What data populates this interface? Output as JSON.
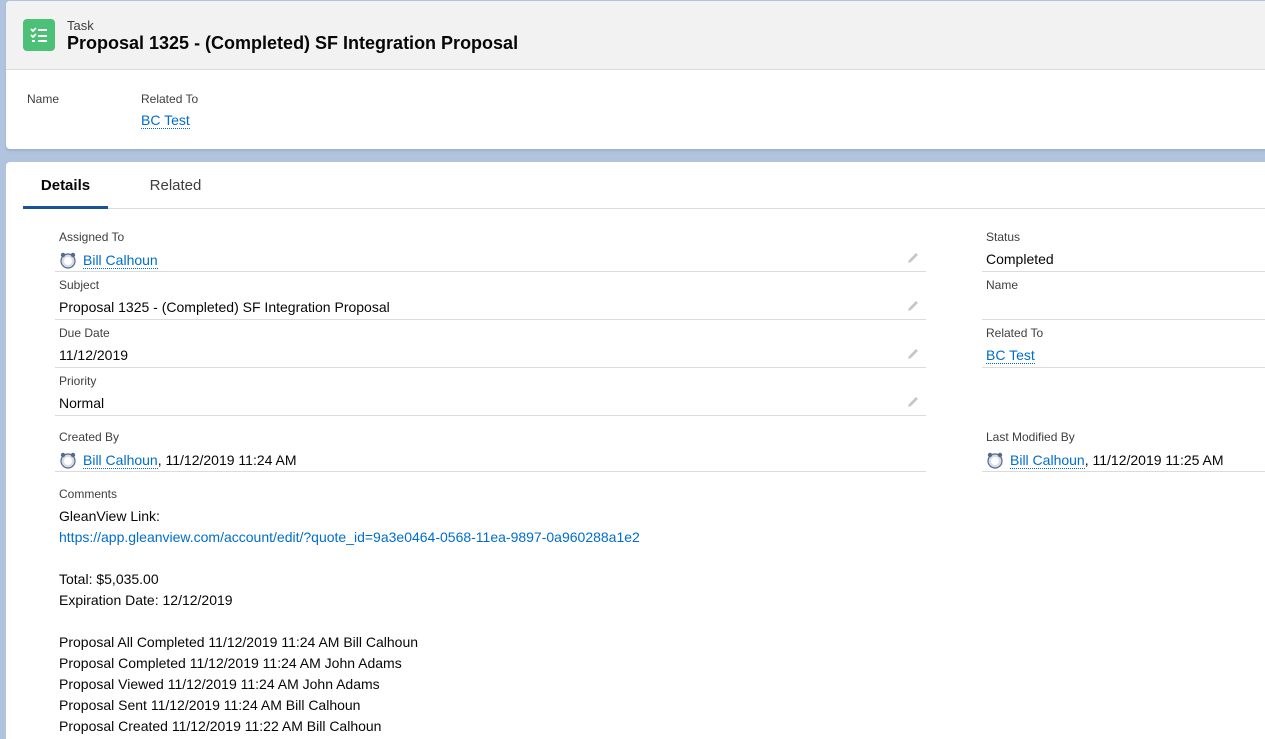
{
  "header": {
    "entity": "Task",
    "title": "Proposal 1325 - (Completed) SF Integration Proposal",
    "icon": "task-checklist-icon",
    "highlights": {
      "name_label": "Name",
      "related_label": "Related To",
      "related_value": "BC Test"
    }
  },
  "tabs": {
    "details": "Details",
    "related": "Related"
  },
  "left": {
    "assigned_to": {
      "label": "Assigned To",
      "value": "Bill Calhoun"
    },
    "subject": {
      "label": "Subject",
      "value": "Proposal 1325 - (Completed) SF Integration Proposal"
    },
    "due_date": {
      "label": "Due Date",
      "value": "11/12/2019"
    },
    "priority": {
      "label": "Priority",
      "value": "Normal"
    },
    "created_by": {
      "label": "Created By",
      "user": "Bill Calhoun",
      "date": ", 11/12/2019 11:24 AM"
    }
  },
  "right": {
    "status": {
      "label": "Status",
      "value": "Completed"
    },
    "name": {
      "label": "Name",
      "value": ""
    },
    "related_to": {
      "label": "Related To",
      "value": "BC Test"
    },
    "modified_by": {
      "label": "Last Modified By",
      "user": "Bill Calhoun",
      "date": ", 11/12/2019 11:25 AM"
    }
  },
  "comments": {
    "label": "Comments",
    "line1": "GleanView Link:",
    "link": "https://app.gleanview.com/account/edit/?quote_id=9a3e0464-0568-11ea-9897-0a960288a1e2",
    "total": "Total: $5,035.00",
    "expiration": "Expiration Date: 12/12/2019",
    "history": [
      "Proposal All Completed 11/12/2019 11:24 AM Bill Calhoun",
      "Proposal Completed 11/12/2019 11:24 AM John Adams",
      "Proposal Viewed 11/12/2019 11:24 AM John Adams",
      "Proposal Sent 11/12/2019 11:24 AM Bill Calhoun",
      "Proposal Created 11/12/2019 11:22 AM Bill Calhoun"
    ]
  },
  "colors": {
    "brand_link": "#006dcc",
    "task_icon": "#4bc076",
    "tab_active": "#1b5297",
    "backdrop": "#b0c4df"
  }
}
